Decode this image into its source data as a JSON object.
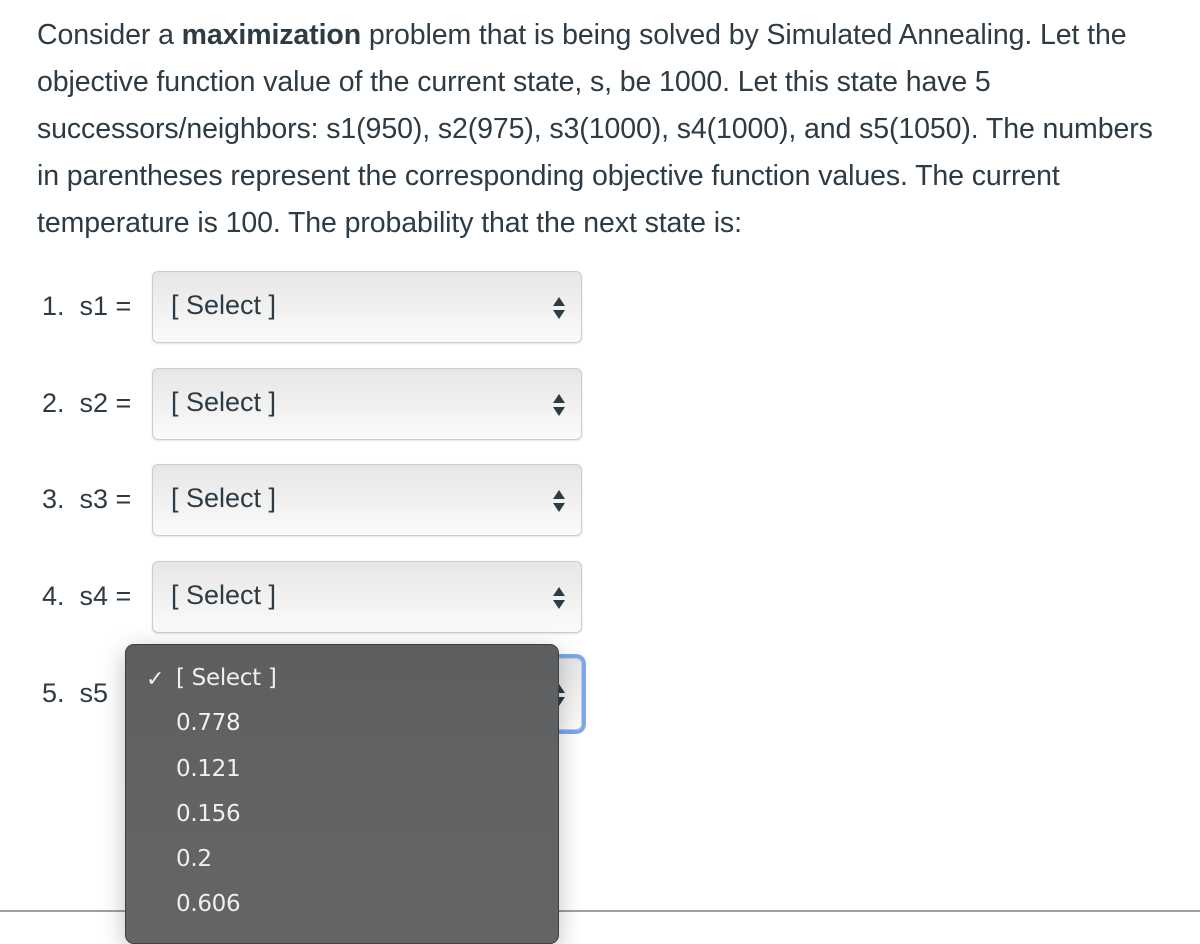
{
  "question": {
    "text_before_bold": "Consider a ",
    "bold": "maximization",
    "text_after_bold": " problem that is being solved by Simulated Annealing. Let the objective function value of the current state, s, be 1000. Let this state have 5 successors/neighbors: s1(950), s2(975), s3(1000), s4(1000), and s5(1050). The numbers in parentheses represent the corresponding objective function values. The current temperature is 100. The probability that the next state is:"
  },
  "answers": [
    {
      "label": "1.  s1 =",
      "selected": "[ Select ]"
    },
    {
      "label": "2.  s2 =",
      "selected": "[ Select ]"
    },
    {
      "label": "3.  s3 =",
      "selected": "[ Select ]"
    },
    {
      "label": "4.  s4 =",
      "selected": "[ Select ]"
    },
    {
      "label": "5.  s5",
      "selected": "[ Select ]"
    }
  ],
  "open_dropdown": {
    "for": "s5",
    "check_icon": "✓",
    "options": [
      "[ Select ]",
      "0.778",
      "0.121",
      "0.156",
      "0.2",
      "0.606"
    ],
    "selected_index": 0
  },
  "colors": {
    "text": "#2d3b45",
    "focus_ring": "#7aa7ef",
    "menu_bg": "#636363",
    "menu_text": "#efefef"
  }
}
